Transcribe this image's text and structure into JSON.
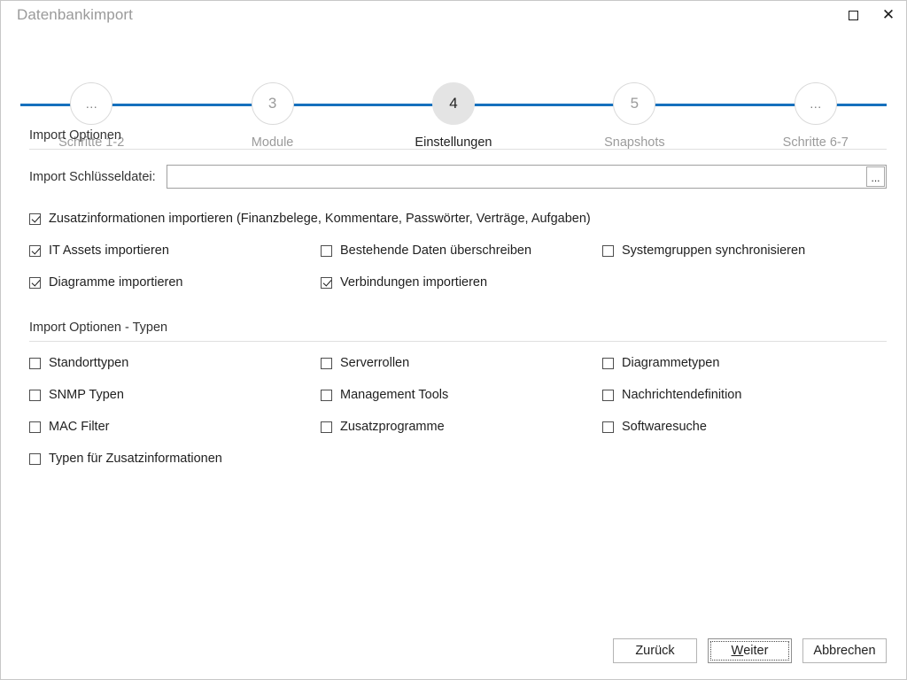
{
  "window": {
    "title": "Datenbankimport",
    "controls": [
      {
        "name": "restore-button",
        "icon": "restore-icon",
        "label": ""
      },
      {
        "name": "close-button",
        "icon": "close-icon",
        "label": "✕"
      }
    ]
  },
  "accent_color": "#1570bd",
  "stepper": {
    "active_index": 2,
    "steps": [
      {
        "badge": "…",
        "label": "Schritte 1-2",
        "active": false
      },
      {
        "badge": "3",
        "label": "Module",
        "active": false
      },
      {
        "badge": "4",
        "label": "Einstellungen",
        "active": true
      },
      {
        "badge": "5",
        "label": "Snapshots",
        "active": false
      },
      {
        "badge": "…",
        "label": "Schritte 6-7",
        "active": false
      }
    ]
  },
  "sections": {
    "import_options": {
      "title": "Import Optionen",
      "file_field": {
        "label": "Import Schlüsseldatei:",
        "value": "",
        "placeholder": "",
        "browse_label": "..."
      },
      "checkbox_full": {
        "label": "Zusatzinformationen importieren (Finanzbelege, Kommentare, Passwörter, Verträge, Aufgaben)",
        "checked": true
      },
      "checkboxes": [
        {
          "label": "IT Assets importieren",
          "checked": true
        },
        {
          "label": "Bestehende Daten überschreiben",
          "checked": false
        },
        {
          "label": "Systemgruppen synchronisieren",
          "checked": false
        },
        {
          "label": "Diagramme importieren",
          "checked": true
        },
        {
          "label": "Verbindungen importieren",
          "checked": true
        },
        {
          "label": "",
          "checked": false
        }
      ]
    },
    "import_options_types": {
      "title": "Import Optionen - Typen",
      "checkboxes": [
        {
          "label": "Standorttypen",
          "checked": false
        },
        {
          "label": "Serverrollen",
          "checked": false
        },
        {
          "label": "Diagrammetypen",
          "checked": false
        },
        {
          "label": "SNMP Typen",
          "checked": false
        },
        {
          "label": "Management Tools",
          "checked": false
        },
        {
          "label": "Nachrichtendefinition",
          "checked": false
        },
        {
          "label": "MAC Filter",
          "checked": false
        },
        {
          "label": "Zusatzprogramme",
          "checked": false
        },
        {
          "label": "Softwaresuche",
          "checked": false
        },
        {
          "label": "Typen für Zusatzinformationen",
          "checked": false
        }
      ]
    }
  },
  "footer": {
    "back_label": "Zurück",
    "next_label_prefix": "",
    "next_mnemonic": "W",
    "next_label_rest": "eiter",
    "cancel_label": "Abbrechen"
  }
}
